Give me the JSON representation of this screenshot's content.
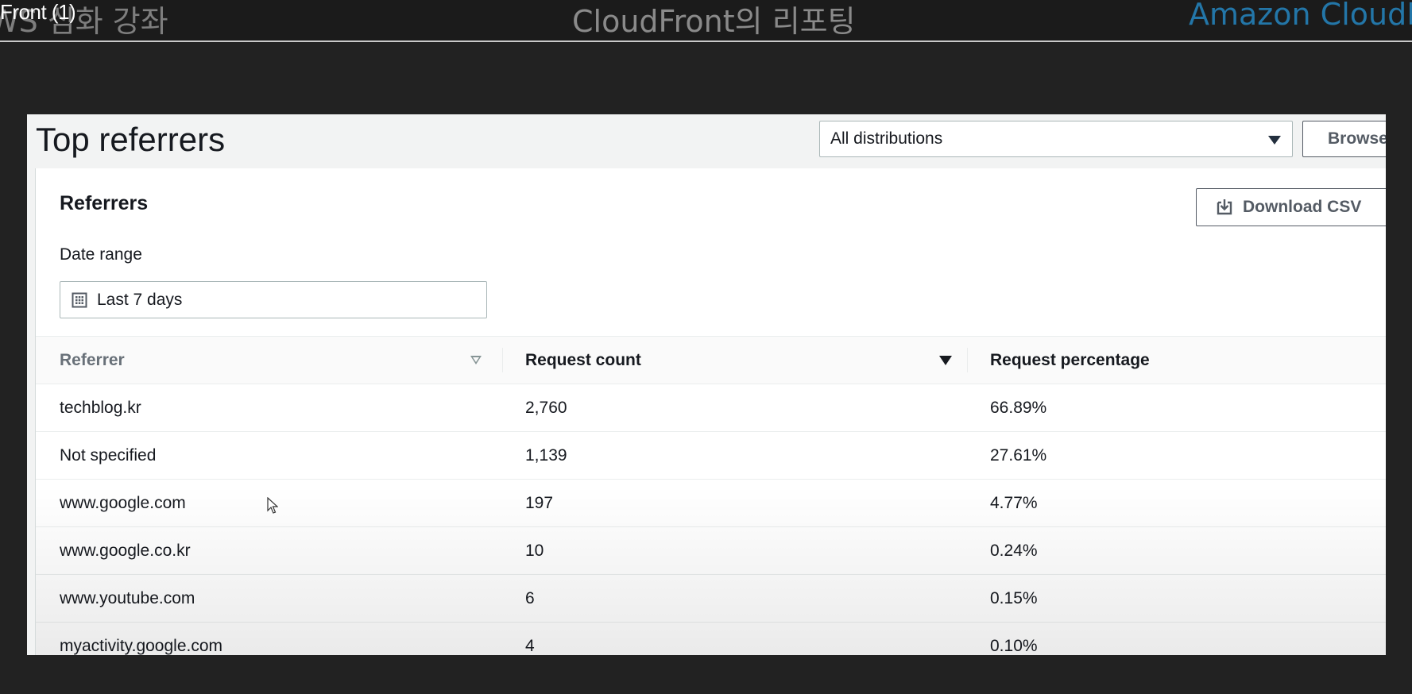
{
  "overlay": {
    "left_title": "WS 심화 강좌",
    "tag": "Front (1)",
    "center_title": "CloudFront의 리포팅",
    "right_title": "Amazon CloudFro"
  },
  "page": {
    "title": "Top referrers",
    "distribution_select": "All distributions",
    "browse_button": "Browse"
  },
  "card": {
    "title": "Referrers",
    "download_button": "Download CSV",
    "date_range_label": "Date range",
    "date_range_value": "Last 7 days"
  },
  "table": {
    "headers": [
      "Referrer",
      "Request count",
      "Request percentage"
    ],
    "rows": [
      {
        "referrer": "techblog.kr",
        "count": "2,760",
        "percentage": "66.89%"
      },
      {
        "referrer": "Not specified",
        "count": "1,139",
        "percentage": "27.61%"
      },
      {
        "referrer": "www.google.com",
        "count": "197",
        "percentage": "4.77%"
      },
      {
        "referrer": "www.google.co.kr",
        "count": "10",
        "percentage": "0.24%"
      },
      {
        "referrer": "www.youtube.com",
        "count": "6",
        "percentage": "0.15%"
      },
      {
        "referrer": "myactivity.google.com",
        "count": "4",
        "percentage": "0.10%"
      }
    ]
  },
  "icons": {
    "download": "download-icon",
    "calendar": "calendar-icon",
    "dropdown": "caret-down-icon",
    "sort": "sort-caret-icon",
    "cursor": "mouse-pointer-icon"
  },
  "colors": {
    "background": "#222222",
    "overlay_right_title": "#2376a8",
    "panel": "#f2f3f3",
    "text": "#16191f",
    "button_border": "#545b64"
  }
}
